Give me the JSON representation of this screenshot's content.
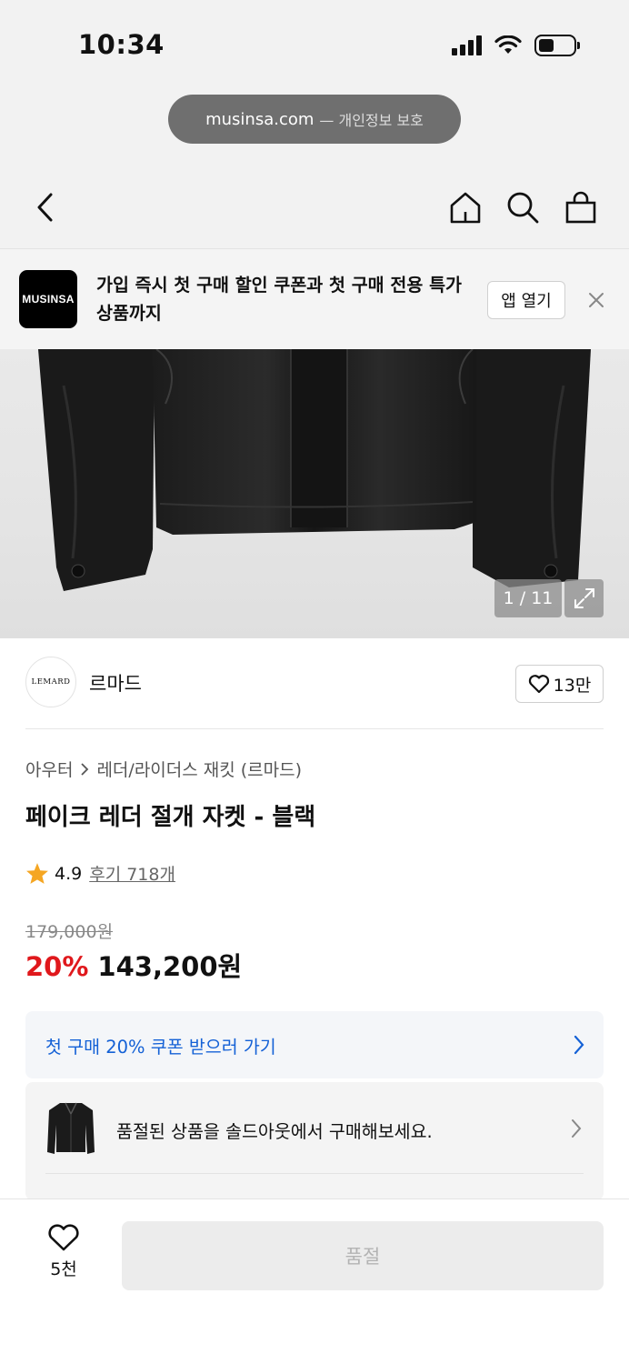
{
  "status_bar": {
    "time": "10:34",
    "icons": [
      "cellular-signal-icon",
      "wifi-icon",
      "battery-icon"
    ]
  },
  "browser": {
    "host": "musinsa.com",
    "privacy_label": "— 개인정보 보호"
  },
  "nav": {
    "icons": [
      "back-chevron-icon",
      "home-icon",
      "search-icon",
      "shopping-bag-icon"
    ]
  },
  "app_banner": {
    "logo_text": "MUSINSA",
    "message": "가입 즉시 첫 구매 할인 쿠폰과 첫 구매 전용 특가 상품까지",
    "open_label": "앱 열기"
  },
  "gallery": {
    "counter": "1 / 11"
  },
  "brand": {
    "logo_text": "LEMARD",
    "name": "르마드",
    "like_count": "13만"
  },
  "product": {
    "breadcrumb": [
      "아우터",
      "레더/라이더스 재킷 (르마드)"
    ],
    "title": "페이크 레더 절개 자켓 - 블랙",
    "rating": "4.9",
    "reviews_label": "후기 718개",
    "original_price": "179,000원",
    "discount": "20%",
    "sale_price": "143,200원"
  },
  "coupon": {
    "label": "첫 구매 20% 쿠폰 받으러 가기"
  },
  "soldout": {
    "message": "품절된 상품을 솔드아웃에서 구매해보세요."
  },
  "bottom_bar": {
    "wish_count": "5천",
    "buy_label": "품절"
  },
  "colors": {
    "accent_red": "#e0181c",
    "link_blue": "#1461d6",
    "star": "#f5a623"
  }
}
